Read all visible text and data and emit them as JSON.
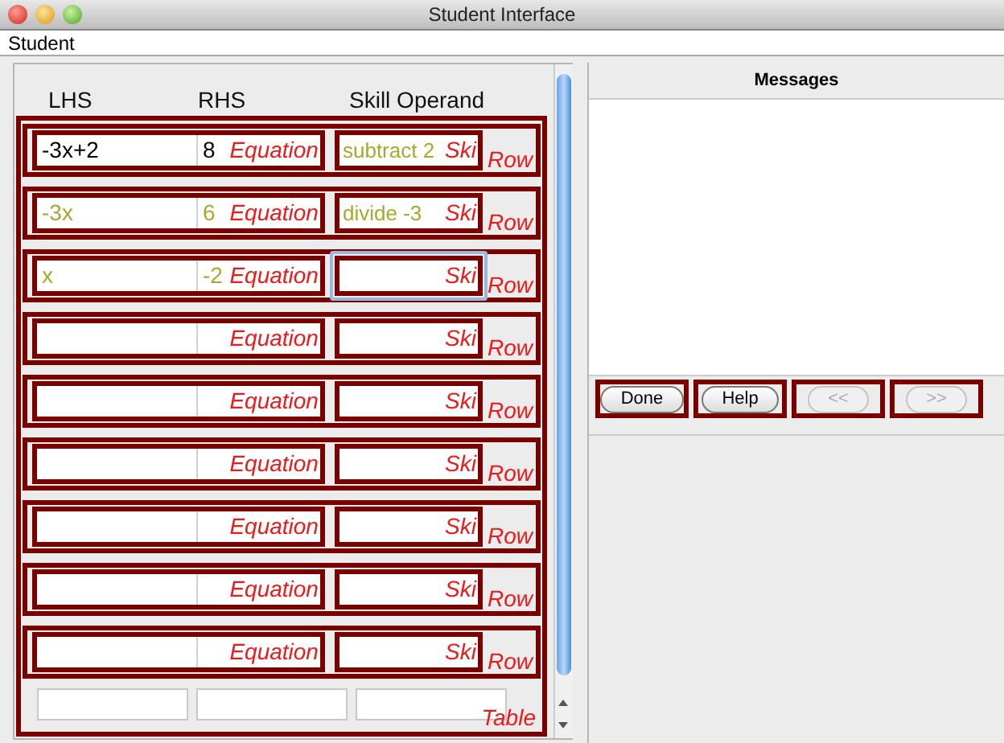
{
  "window": {
    "title": "Student Interface"
  },
  "menu": [
    "Student"
  ],
  "columns": [
    "LHS",
    "RHS",
    "Skill Operand"
  ],
  "rows": [
    {
      "lhs": {
        "text": "-3x+2",
        "correct": false
      },
      "rhs": {
        "text": "8",
        "correct": false
      },
      "skill": {
        "text": "subtract 2",
        "correct": true,
        "focused": false
      },
      "equation_label": "Equation",
      "skill_label": "Ski",
      "row_label": "Row"
    },
    {
      "lhs": {
        "text": "-3x",
        "correct": true
      },
      "rhs": {
        "text": "6",
        "correct": true
      },
      "skill": {
        "text": "divide -3",
        "correct": true,
        "focused": false
      },
      "equation_label": "Equation",
      "skill_label": "Ski",
      "row_label": "Row"
    },
    {
      "lhs": {
        "text": "x",
        "correct": true
      },
      "rhs": {
        "text": "-2",
        "correct": true
      },
      "skill": {
        "focused": true
      },
      "equation_label": "Equation",
      "skill_label": "Ski",
      "row_label": "Row"
    },
    {
      "skill": {
        "focused": false
      },
      "equation_label": "Equation",
      "skill_label": "Ski",
      "row_label": "Row"
    },
    {
      "skill": {
        "focused": false
      },
      "equation_label": "Equation",
      "skill_label": "Ski",
      "row_label": "Row"
    },
    {
      "skill": {
        "focused": false
      },
      "equation_label": "Equation",
      "skill_label": "Ski",
      "row_label": "Row"
    },
    {
      "skill": {
        "focused": false
      },
      "equation_label": "Equation",
      "skill_label": "Ski",
      "row_label": "Row"
    },
    {
      "skill": {
        "focused": false
      },
      "equation_label": "Equation",
      "skill_label": "Ski",
      "row_label": "Row"
    },
    {
      "skill": {
        "focused": false
      },
      "equation_label": "Equation",
      "skill_label": "Ski",
      "row_label": "Row"
    }
  ],
  "table_label": "Table",
  "messages": {
    "title": "Messages"
  },
  "buttons": [
    {
      "label": "Done",
      "disabled": false
    },
    {
      "label": "Help",
      "disabled": false
    },
    {
      "label": "<<",
      "disabled": true
    },
    {
      "label": ">>",
      "disabled": true
    }
  ]
}
